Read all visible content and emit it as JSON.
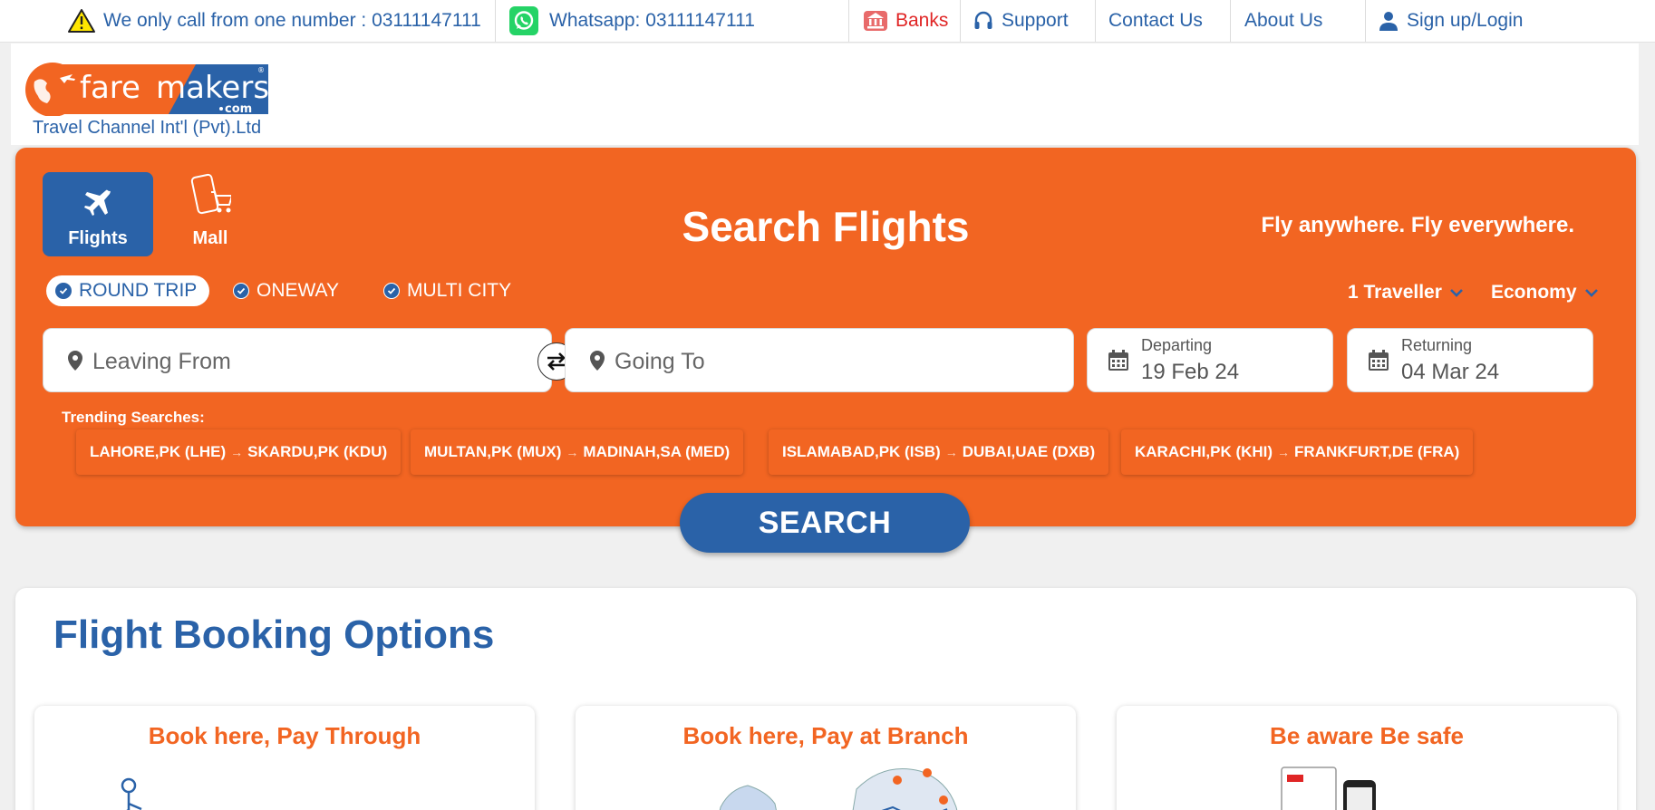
{
  "topbar": {
    "notice": "We only call from one number : 03111147111",
    "whatsapp": "Whatsapp: 03111147111",
    "banks": "Banks",
    "support": "Support",
    "contact": "Contact Us",
    "about": "About Us",
    "signin": "Sign up/Login"
  },
  "brand": {
    "logo_word1": "fare",
    "logo_word2": "makers",
    "logo_suffix": "com",
    "tagline": "Travel Channel Int'l (Pvt).Ltd"
  },
  "search": {
    "tabs": [
      {
        "label": "Flights",
        "icon": "plane-icon",
        "active": true
      },
      {
        "label": "Mall",
        "icon": "shopping-icon",
        "active": false
      }
    ],
    "title": "Search Flights",
    "slogan": "Fly anywhere. Fly everywhere.",
    "trip_types": [
      {
        "label": "ROUND TRIP",
        "selected": true
      },
      {
        "label": "ONEWAY",
        "selected": false
      },
      {
        "label": "MULTI CITY",
        "selected": false
      }
    ],
    "travellers": "1 Traveller",
    "cabin": "Economy",
    "from_placeholder": "Leaving From",
    "to_placeholder": "Going To",
    "departing_label": "Departing",
    "departing_value": "19 Feb 24",
    "returning_label": "Returning",
    "returning_value": "04 Mar 24",
    "trending_label": "Trending Searches:",
    "trending": [
      {
        "from": "LAHORE,PK (LHE)",
        "to": "SKARDU,PK (KDU)"
      },
      {
        "from": "MULTAN,PK (MUX)",
        "to": "MADINAH,SA (MED)"
      },
      {
        "from": "ISLAMABAD,PK (ISB)",
        "to": "DUBAI,UAE (DXB)"
      },
      {
        "from": "KARACHI,PK (KHI)",
        "to": "FRANKFURT,DE (FRA)"
      }
    ],
    "search_button": "SEARCH"
  },
  "booking": {
    "title": "Flight Booking Options",
    "cards": [
      {
        "title": "Book here, Pay Through"
      },
      {
        "title": "Book here, Pay at Branch"
      },
      {
        "title": "Be aware Be safe"
      }
    ]
  },
  "colors": {
    "brand_orange": "#f26522",
    "brand_blue": "#2a62a8"
  }
}
